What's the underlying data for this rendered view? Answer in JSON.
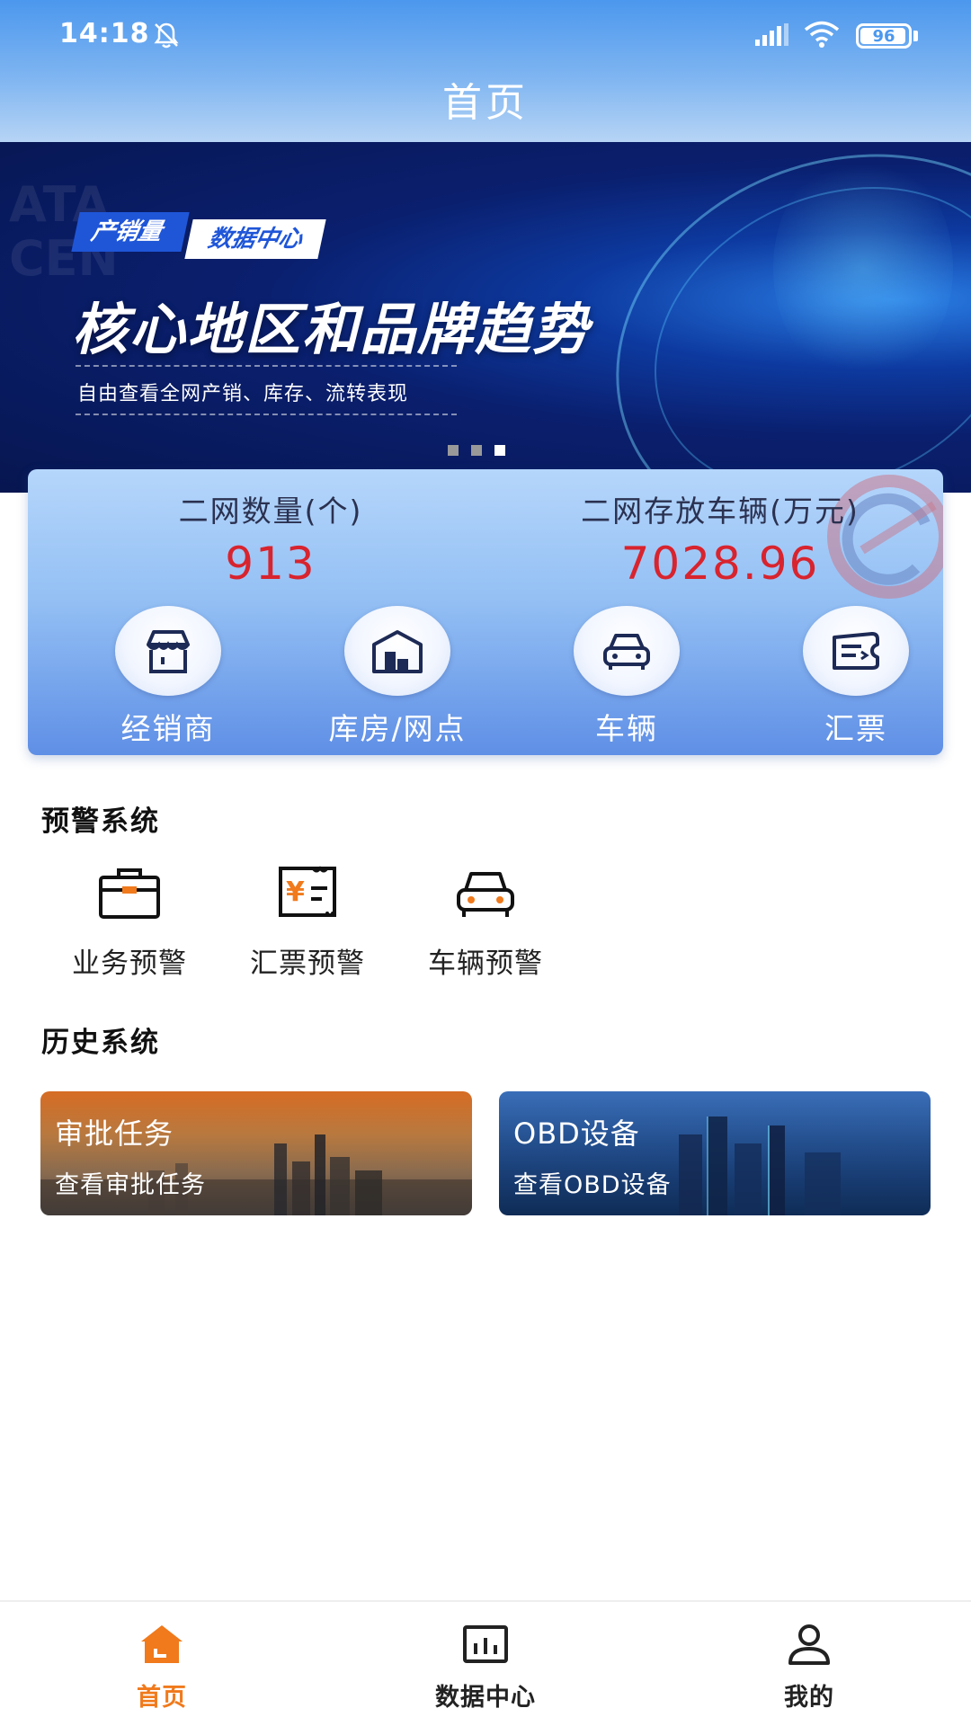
{
  "status_bar": {
    "time": "14:18",
    "battery": "96"
  },
  "header": {
    "title": "首页"
  },
  "banner": {
    "tag_left": "产销量",
    "tag_right": "数据中心",
    "headline": "核心地区和品牌趋势",
    "subline": "自由查看全网产销、库存、流转表现",
    "side_letters": "ATA CEN",
    "slide_count": 3,
    "active_slide": 3
  },
  "stats": [
    {
      "label": "二网数量(个)",
      "value": "913"
    },
    {
      "label": "二网存放车辆(万元)",
      "value": "7028.96"
    }
  ],
  "shortcuts": [
    {
      "label": "经销商",
      "icon": "store-icon"
    },
    {
      "label": "库房/网点",
      "icon": "warehouse-icon"
    },
    {
      "label": "车辆",
      "icon": "car-icon"
    },
    {
      "label": "汇票",
      "icon": "ticket-icon"
    }
  ],
  "warning_section": {
    "title": "预警系统",
    "items": [
      {
        "label": "业务预警",
        "icon": "briefcase-icon"
      },
      {
        "label": "汇票预警",
        "icon": "bill-icon"
      },
      {
        "label": "车辆预警",
        "icon": "car-icon"
      }
    ]
  },
  "history_section": {
    "title": "历史系统",
    "cards": [
      {
        "title": "审批任务",
        "subtitle": "查看审批任务"
      },
      {
        "title": "OBD设备",
        "subtitle": "查看OBD设备"
      }
    ]
  },
  "bottom_nav": [
    {
      "label": "首页",
      "icon": "home-icon",
      "active": true
    },
    {
      "label": "数据中心",
      "icon": "bar-chart-icon",
      "active": false
    },
    {
      "label": "我的",
      "icon": "user-icon",
      "active": false
    }
  ],
  "colors": {
    "accent": "#f07a1c",
    "value_red": "#d8242e",
    "header_blue": "#4c98ee",
    "card_blue": "#5f8fe6"
  }
}
